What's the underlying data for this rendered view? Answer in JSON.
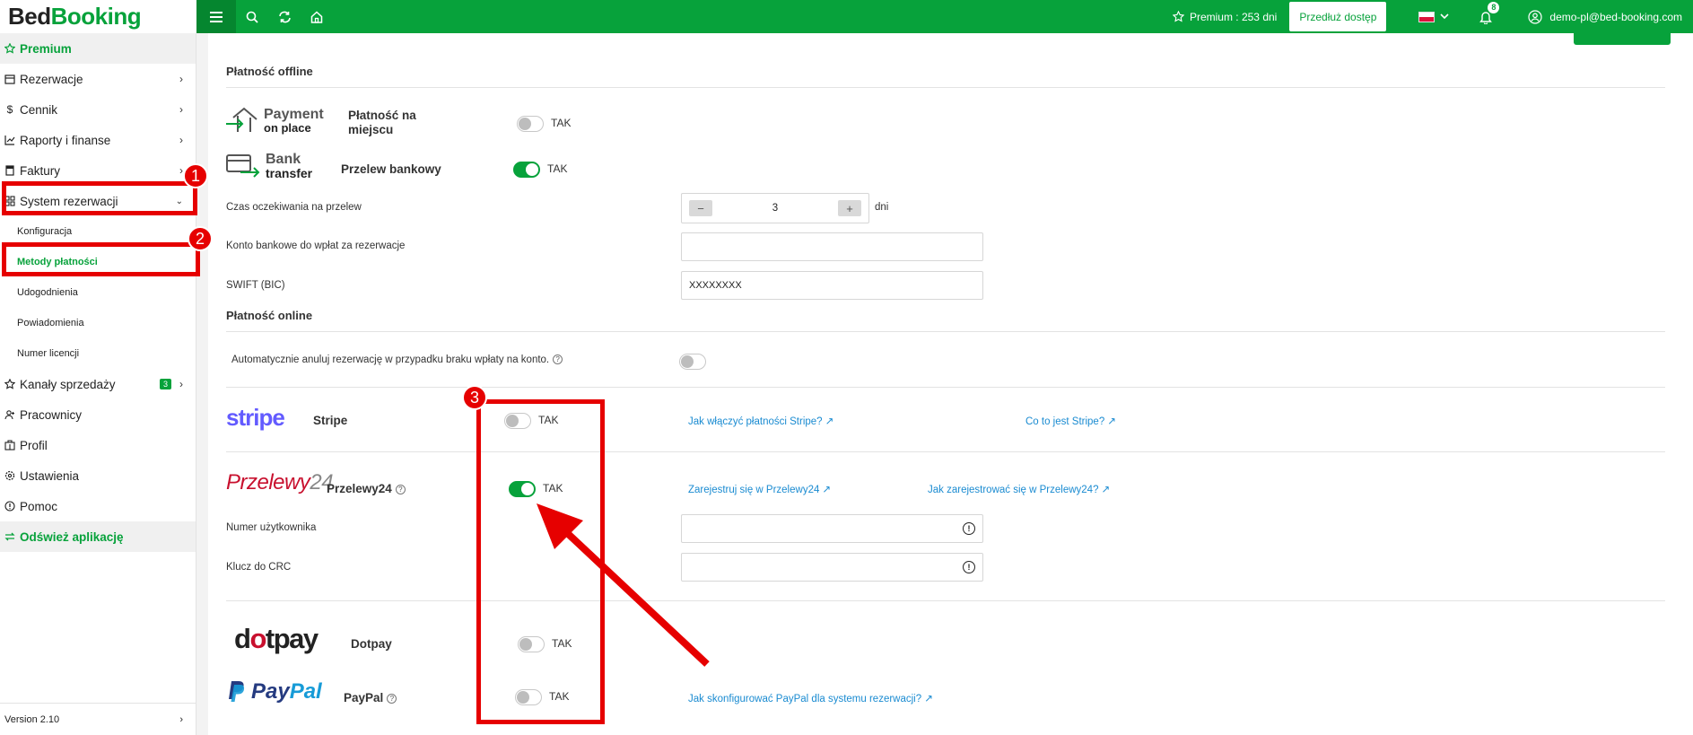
{
  "app": {
    "brand_part1": "Bed",
    "brand_part2": "Booking",
    "premium_status": "Premium : 253 dni",
    "extend_label": "Przedłuż dostęp",
    "notifications_count": "8",
    "user_email": "demo-pl@bed-booking.com",
    "version": "Version 2.10"
  },
  "sidebar": {
    "premium": "Premium",
    "reservations": "Rezerwacje",
    "pricing": "Cennik",
    "reports": "Raporty i finanse",
    "invoices": "Faktury",
    "booking_system": "System rezerwacji",
    "sub": {
      "config": "Konfiguracja",
      "payment_methods": "Metody płatności",
      "agreements": "Udogodnienia",
      "notifications": "Powiadomienia",
      "license": "Numer licencji"
    },
    "sales_channels": "Kanały sprzedaży",
    "sales_channels_badge": "3",
    "employees": "Pracownicy",
    "profile": "Profil",
    "settings": "Ustawienia",
    "help": "Pomoc",
    "refresh": "Odśwież aplikację"
  },
  "offline": {
    "title": "Płatność offline",
    "on_place_logo_top": "Payment",
    "on_place_logo_bottom": "on place",
    "on_place_name_1": "Płatność na",
    "on_place_name_2": "miejscu",
    "bank_logo_top": "Bank",
    "bank_logo_bottom": "transfer",
    "bank_name": "Przelew bankowy",
    "wait_label": "Czas oczekiwania na przelew",
    "wait_value": "3",
    "wait_unit": "dni",
    "account_label": "Konto bankowe do wpłat za rezerwacje",
    "account_value": "",
    "swift_label": "SWIFT (BIC)",
    "swift_value": "XXXXXXXX"
  },
  "online": {
    "title": "Płatność online",
    "auto_cancel_label": "Automatycznie anuluj rezerwację w przypadku braku wpłaty na konto.",
    "stripe_logo": "stripe",
    "stripe_name": "Stripe",
    "stripe_link1": "Jak włączyć płatności Stripe?",
    "stripe_link2": "Co to jest Stripe?",
    "p24_logo_1": "Przelewy",
    "p24_logo_2": "24",
    "p24_name": "Przelewy24",
    "p24_link1": "Zarejestruj się w Przelewy24",
    "p24_link2": "Jak zarejestrować się w Przelewy24?",
    "user_number_label": "Numer użytkownika",
    "crc_label": "Klucz do CRC",
    "dotpay_logo_1": "d",
    "dotpay_logo_2": "o",
    "dotpay_logo_3": "tpay",
    "dotpay_name": "Dotpay",
    "paypal_logo_1": "Pay",
    "paypal_logo_2": "Pal",
    "paypal_name": "PayPal",
    "paypal_link": "Jak skonfigurować PayPal dla systemu rezerwacji?"
  },
  "toggle_label": "TAK",
  "toggles": {
    "on_place": false,
    "bank_transfer": true,
    "auto_cancel": false,
    "stripe": false,
    "przelewy24": true,
    "dotpay": false,
    "paypal": false
  },
  "markers": [
    "1",
    "2",
    "3"
  ],
  "colors": {
    "brand_green": "#07a23b",
    "annotation_red": "#e60000",
    "link_blue": "#1a8bd1"
  }
}
